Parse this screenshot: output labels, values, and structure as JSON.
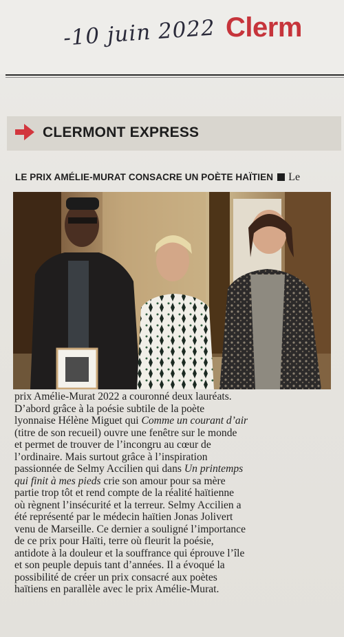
{
  "clipping": {
    "handwritten_date": "-10 juin 2022",
    "masthead_fragment": "Clerm"
  },
  "section": {
    "arrow_icon": "right-arrow-icon",
    "title": "CLERMONT EXPRESS",
    "accent_color": "#d2363d"
  },
  "article": {
    "headline": "LE PRIX AMÉLIE-MURAT CONSACRE UN POÈTE HAÏTIEN",
    "lead_word": "Le",
    "photo_subject": "photo",
    "photo_frame_subject": "framed-portrait",
    "body_lines": [
      [
        {
          "t": "prix Amélie-Murat 2022 a couronné deux lauréats."
        }
      ],
      [
        {
          "t": "D’abord grâce à la poésie subtile de la poète"
        }
      ],
      [
        {
          "t": "lyonnaise Hélène Miguet qui "
        },
        {
          "t": "Comme un courant d’air",
          "i": true
        }
      ],
      [
        {
          "t": "(titre de son recueil) ouvre une fenêtre sur le monde"
        }
      ],
      [
        {
          "t": "et permet de trouver de l’incongru au cœur de"
        }
      ],
      [
        {
          "t": "l’ordinaire. Mais surtout grâce à l’inspiration"
        }
      ],
      [
        {
          "t": "passionnée de Selmy Accilien qui dans "
        },
        {
          "t": "Un printemps",
          "i": true
        }
      ],
      [
        {
          "t": "qui finit à mes pieds",
          "i": true
        },
        {
          "t": " crie son amour pour sa mère"
        }
      ],
      [
        {
          "t": "partie trop tôt et rend compte de la réalité haïtienne"
        }
      ],
      [
        {
          "t": "où règnent l’insécurité et la terreur. Selmy Accilien a"
        }
      ],
      [
        {
          "t": "été représenté par le médecin haïtien Jonas Jolivert"
        }
      ],
      [
        {
          "t": "venu de Marseille. Ce dernier a souligné l’importance"
        }
      ],
      [
        {
          "t": "de ce prix pour Haïti, terre où fleurit la poésie,"
        }
      ],
      [
        {
          "t": "antidote à la douleur et la souffrance qui éprouve l’île"
        }
      ],
      [
        {
          "t": "et son peuple depuis tant d’années. Il a évoqué la"
        }
      ],
      [
        {
          "t": "possibilité de créer un prix consacré aux poètes"
        }
      ],
      [
        {
          "t": "haïtiens en parallèle avec le prix Amélie-Murat."
        }
      ]
    ]
  }
}
